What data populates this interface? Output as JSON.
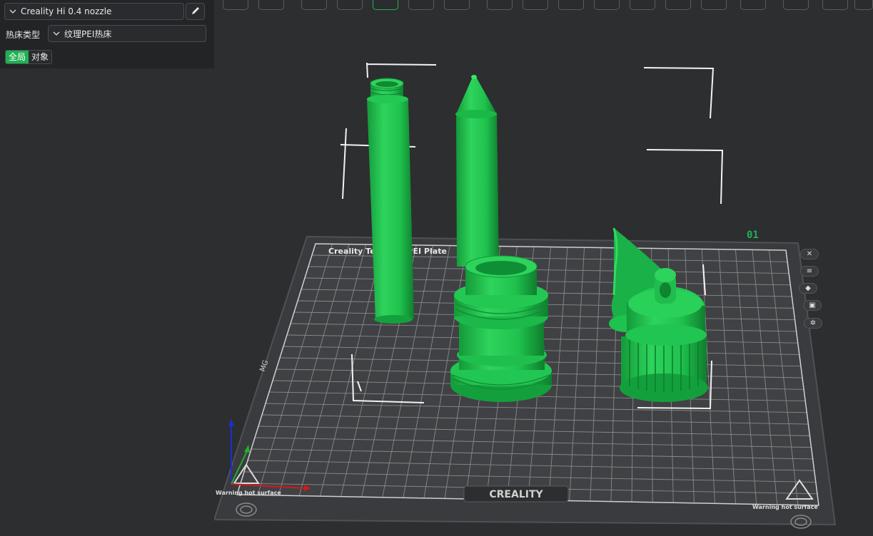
{
  "printer": {
    "name": "Creality Hi 0.4 nozzle"
  },
  "bed": {
    "label": "热床类型",
    "value": "纹理PEI热床"
  },
  "scope_tabs": {
    "global": "全局",
    "object": "对象"
  },
  "plate": {
    "number": "01",
    "brand_text": "CREALITY",
    "plate_title": "Creality Textured PEI Plate",
    "warning_left": "Warning hot surface",
    "warning_right": "Warning hot surface",
    "edge_text": "MG"
  },
  "colors": {
    "accent": "#1fb152",
    "model": "#1fc24d",
    "background": "#2d2e30",
    "panel": "#232426",
    "plate": "#3f4043",
    "grid": "#bdbdbd",
    "axis_x": "#d41a1a",
    "axis_y": "#1fb12e",
    "axis_z": "#1a2fd4"
  },
  "icons": {
    "printer_combo": "chevron-down-icon",
    "bed_combo": "chevron-down-icon",
    "edit": "pencil-icon",
    "side": [
      "close-icon",
      "list-icon",
      "auto-orient-icon",
      "lock-icon",
      "gear-icon"
    ]
  }
}
